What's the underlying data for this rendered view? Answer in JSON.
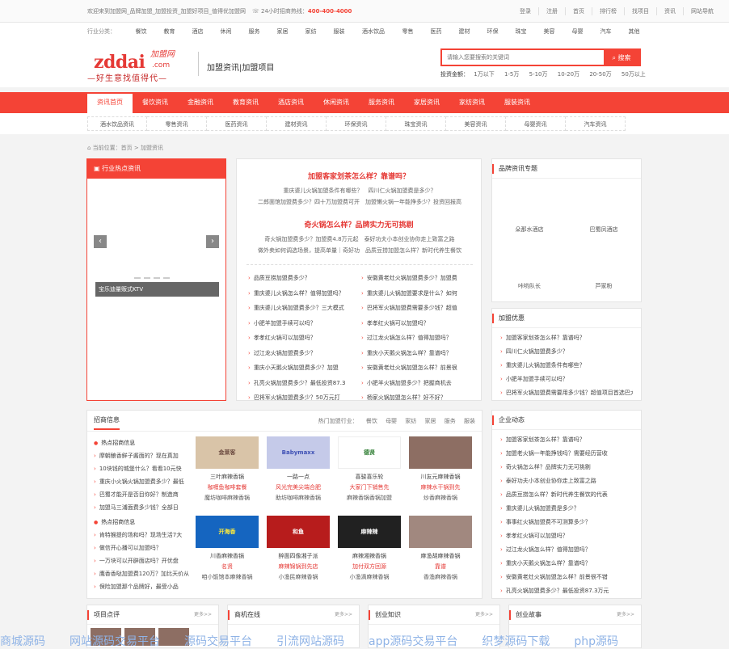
{
  "topbar": {
    "welcome": "欢迎来到加盟网_品牌加盟_加盟投资_加盟好项目_值得优加盟网",
    "hotline_label": "24小时招商热线：",
    "hotline": "400-400-4000",
    "links": [
      "登录",
      "注册",
      "首页",
      "排行榜",
      "找项目",
      "资讯",
      "网站导航"
    ]
  },
  "industry": {
    "label": "行业分类：",
    "items": [
      "餐饮",
      "教育",
      "酒店",
      "休闲",
      "服务",
      "家居",
      "家纺",
      "服装",
      "酒水饮品",
      "零售",
      "医药",
      "建材",
      "环保",
      "珠宝",
      "美容",
      "母婴",
      "汽车",
      "其他"
    ]
  },
  "header": {
    "logo_main": "zddai",
    "logo_cn": "加盟网",
    "logo_com": ".com",
    "slogan": "—好生意找值得代—",
    "subtitle": "加盟资讯|加盟项目",
    "search_placeholder": "请输入您要搜索的关键词",
    "search_button": "搜索",
    "amount_label": "投资金额：",
    "amounts": [
      "1万以下",
      "1-5万",
      "5-10万",
      "10-20万",
      "20-50万",
      "50万以上"
    ]
  },
  "nav": {
    "items": [
      "资讯首页",
      "餐饮资讯",
      "金融资讯",
      "教育资讯",
      "酒店资讯",
      "休闲资讯",
      "服务资讯",
      "家居资讯",
      "家纺资讯",
      "服装资讯"
    ]
  },
  "subnav": {
    "items": [
      "酒水饮品资讯",
      "零售资讯",
      "医药资讯",
      "建材资讯",
      "环保资讯",
      "珠宝资讯",
      "美容资讯",
      "母婴资讯",
      "汽车资讯"
    ]
  },
  "breadcrumb": {
    "text": "当前位置：首页 > 加盟资讯"
  },
  "hot": {
    "title": "行业热点资讯",
    "caption": "宝乐迪量贩式KTV",
    "prev": "‹",
    "next": "›"
  },
  "headline": {
    "h1": "加盟客家划茶怎么样？靠谱吗？",
    "p1a": "重庆婆儿火锅加盟条件有哪些？",
    "p1b": "四川仁火锅加盟费是多少？",
    "p1c": "二郎面馆加盟费多少？四十万加盟费可开",
    "p1d": "加盟懒火锅一年能挣多少？投资回报高",
    "h2": "奇火锅怎么样？品牌实力无可挑剔",
    "p2a": "奇火锅加盟费多少？加盟费4.8万元起",
    "p2b": "泰好功夫小本创业协你走上致富之路",
    "p2c": "做外卖如何调选场景，提高单量｜奇好功",
    "p2d": "品质豆捞加盟怎么样？新时代养生餐饮",
    "left": [
      "品质豆捞加盟费多少？",
      "重庆婆儿火锅怎么样？值得加盟吗？",
      "重庆婆儿火锅加盟费多少？三大模式",
      "小肥羊加盟手续可以吗？",
      "孝孝红火锅可以加盟吗？",
      "过江龙火锅加盟费多少？",
      "重庆小天鹅火锅加盟费多少？加盟",
      "孔亮火锅加盟费多少？最低投资87.3",
      "巴将军火锅加盟费多少？50万元打"
    ],
    "right": [
      "安徽黄老灶火锅加盟费多少？加盟费",
      "重庆婆儿火锅加盟要求是什么？如何",
      "巴将军火锅加盟费需要多少钱？超值",
      "孝孝红火锅可以加盟吗？",
      "过江龙火锅怎么样？值得加盟吗？",
      "重庆小天鹅火锅怎么样？靠谱吗？",
      "安徽黄老灶火锅加盟怎么样？前景很",
      "小肥羊火锅加盟多少？把握商机去",
      "杨家火锅加盟怎么样？好不好？"
    ]
  },
  "brand": {
    "title": "品牌资讯专题",
    "items": [
      "朵那水酒店",
      "巴蜀凤酒店",
      "咔哟队长",
      "芦家粉"
    ]
  },
  "join": {
    "title": "加盟优惠",
    "items": [
      "加盟客家划茶怎么样？靠谱吗？",
      "四川仁火锅加盟费多少？",
      "重庆婆儿火锅加盟条件有哪些？",
      "小肥羊加盟手续可以吗？",
      "巴将军火锅加盟费需要用多少钱？超值项目首选巴大多了"
    ]
  },
  "recruit": {
    "title": "招商信息",
    "tags_label": "热门加盟行业：",
    "tags": [
      "餐饮",
      "母婴",
      "家纺",
      "家居",
      "服务",
      "服装"
    ],
    "g1_title": "热点招商信息",
    "g1": [
      "摩朝酿香鲜子酱面的？现在真加",
      "10块钱的城堡什么？看看10元快",
      "重庆小火锅火锅加盟费多少？最低",
      "巴蜀才能开是否目你好？制造商",
      "加盟马三浦面费多少钱？全部日"
    ],
    "g2_title": "热点招商信息",
    "g2": [
      "肯特猴提的场和吗？现场生活7大",
      "做信开心播可以加盟吗？",
      "一万块可以开辟面店吗？开优盘",
      "鹰香香哒加盟费120万？加比天价从",
      "保险加盟那个品牌好，最受小品"
    ],
    "cards": [
      {
        "n": "三叶麻辣香锅",
        "s": "咖喱鱼咖啡套餐",
        "c": "魔坊咖啡麻辣香锅",
        "bg": "#d9c4a8",
        "lbl": "金莱客"
      },
      {
        "n": "一路一点",
        "s": "风光完美尖端合肥",
        "c": "助坊咖啡麻辣香锅",
        "bg": "#3f51b5",
        "lbl": "Babymaxx"
      },
      {
        "n": "喜骏喜乐轮",
        "s": "大家门下销售先",
        "c": "麻辣香锅香锅加盟",
        "bg": "#ffffff",
        "lbl": "德贤"
      },
      {
        "n": "川友元麻辣香锅",
        "s": "麻辣水干锅到先",
        "c": "炒香麻辣香锅",
        "bg": "#8d6e63",
        "lbl": ""
      },
      {
        "n": "川香麻辣香锅",
        "s": "名贤",
        "c": "咱小饭馆本麻辣香锅",
        "bg": "#1565c0",
        "lbl": "开海香"
      },
      {
        "n": "醉面四像湘子派",
        "s": "麻辣锦锅到先店",
        "c": "小渔民麻辣香锅",
        "bg": "#b71c1c",
        "lbl": "和鱼"
      },
      {
        "n": "麻辣湘辣香锅",
        "s": "加付双方回源",
        "c": "小渔滴麻辣香锅",
        "bg": "#212121",
        "lbl": "麻辣辣"
      },
      {
        "n": "麻渔胡麻辣香锅",
        "s": "靠谱",
        "c": "香渔麻辣香锅",
        "bg": "#a1887f",
        "lbl": ""
      }
    ]
  },
  "enterprise": {
    "title": "企业动态",
    "items": [
      "加盟客家划茶怎么样？靠谱吗？",
      "加盟老火锅一年能挣钱吗？需要经历营收",
      "奇火锅怎么样？品牌实力无可挑剔",
      "泰好功夫小本创业协你走上致富之路",
      "品质豆捞怎么样？新时代养生餐饮的代表",
      "重庆婆儿火锅加盟费是多少？",
      "事事红火锅加盟费不可测算多少？",
      "孝孝红火锅可以加盟吗？",
      "过江龙火锅怎么样？值得加盟吗？",
      "重庆小天鹅火锅怎么样？靠谱吗？",
      "安徽黄老灶火锅加盟怎么样？前景很不错",
      "孔亮火锅加盟费多少？最低投资87.3万元"
    ]
  },
  "bottom": [
    {
      "title": "项目点评",
      "more": "更多>>"
    },
    {
      "title": "商机在线",
      "more": "更多>>"
    },
    {
      "title": "创业知识",
      "more": "更多>>"
    },
    {
      "title": "创业故事",
      "more": "更多>>"
    }
  ],
  "marquee": [
    "商城源码",
    "网站源码交易平台",
    "源码交易平台",
    "引流网站源码",
    "app源码交易平台",
    "织梦源码下载",
    "php源码"
  ]
}
